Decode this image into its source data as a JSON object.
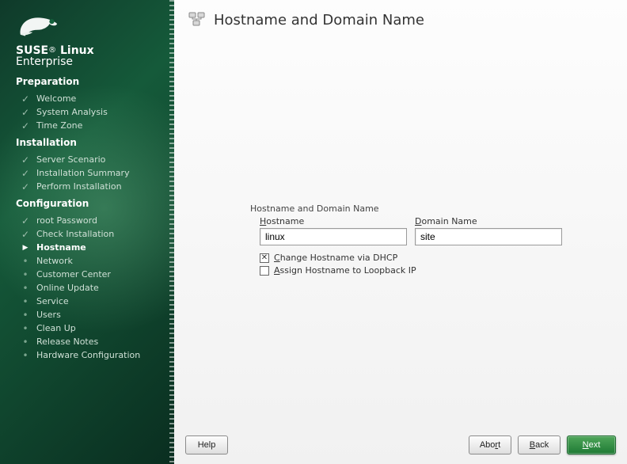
{
  "brand": {
    "line1_a": "SUSE",
    "line1_b": "Linux",
    "line2": "Enterprise",
    "reg": "®"
  },
  "sidebar": {
    "sections": {
      "preparation": {
        "title": "Preparation",
        "items": [
          {
            "label": "Welcome",
            "icon": "check"
          },
          {
            "label": "System Analysis",
            "icon": "check"
          },
          {
            "label": "Time Zone",
            "icon": "check"
          }
        ]
      },
      "installation": {
        "title": "Installation",
        "items": [
          {
            "label": "Server Scenario",
            "icon": "check"
          },
          {
            "label": "Installation Summary",
            "icon": "check"
          },
          {
            "label": "Perform Installation",
            "icon": "check"
          }
        ]
      },
      "configuration": {
        "title": "Configuration",
        "items": [
          {
            "label": "root Password",
            "icon": "check"
          },
          {
            "label": "Check Installation",
            "icon": "check"
          },
          {
            "label": "Hostname",
            "icon": "arrow",
            "current": true
          },
          {
            "label": "Network",
            "icon": "dot"
          },
          {
            "label": "Customer Center",
            "icon": "dot"
          },
          {
            "label": "Online Update",
            "icon": "dot"
          },
          {
            "label": "Service",
            "icon": "dot"
          },
          {
            "label": "Users",
            "icon": "dot"
          },
          {
            "label": "Clean Up",
            "icon": "dot"
          },
          {
            "label": "Release Notes",
            "icon": "dot"
          },
          {
            "label": "Hardware Configuration",
            "icon": "dot"
          }
        ]
      }
    }
  },
  "header": {
    "title": "Hostname and Domain Name"
  },
  "form": {
    "group_label": "Hostname and Domain Name",
    "hostname": {
      "label_pre": "",
      "label_u": "H",
      "label_post": "ostname",
      "value": "linux"
    },
    "domain": {
      "label_pre": "",
      "label_u": "D",
      "label_post": "omain Name",
      "value": "site"
    },
    "cb_dhcp": {
      "checked": true,
      "pre": "",
      "u": "C",
      "post": "hange Hostname via DHCP"
    },
    "cb_loop": {
      "checked": false,
      "pre": "",
      "u": "A",
      "post": "ssign Hostname to Loopback IP"
    }
  },
  "footer": {
    "help": {
      "pre": "",
      "u": "",
      "post": "Help"
    },
    "abort": {
      "pre": "Abo",
      "u": "r",
      "post": "t"
    },
    "back": {
      "pre": "",
      "u": "B",
      "post": "ack"
    },
    "next": {
      "pre": "",
      "u": "N",
      "post": "ext"
    }
  }
}
